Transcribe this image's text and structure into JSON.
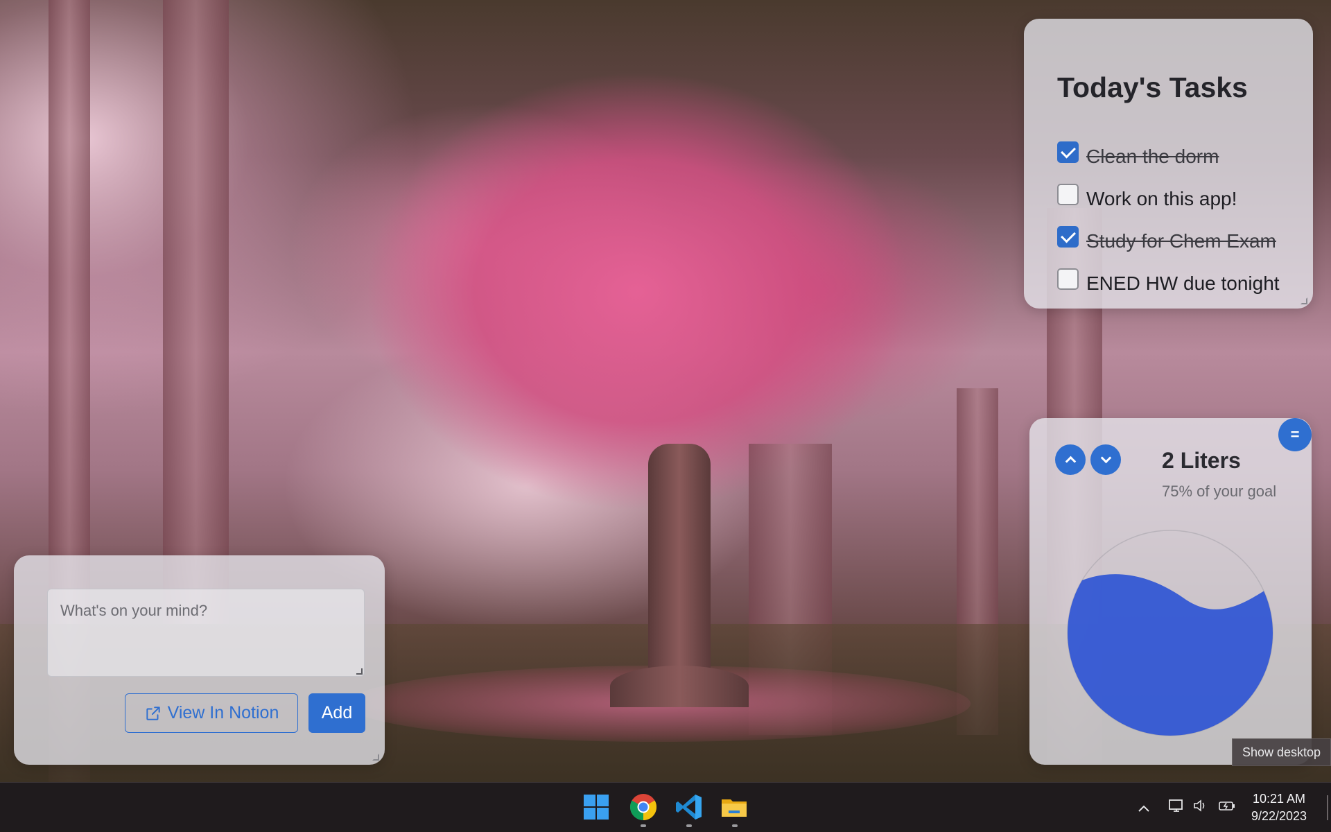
{
  "tasks_widget": {
    "title": "Today's Tasks",
    "items": [
      {
        "label": "Clean the dorm",
        "checked": true
      },
      {
        "label": "Work on this app!",
        "checked": false
      },
      {
        "label": "Study for Chem Exam",
        "checked": true
      },
      {
        "label": "ENED HW due tonight",
        "checked": false
      }
    ]
  },
  "water_widget": {
    "amount": "2 Liters",
    "goal_text": "75% of your goal",
    "progress_fraction": 0.75,
    "fill_color": "#2f55d4",
    "menu_label": "="
  },
  "notes_widget": {
    "placeholder": "What's on your mind?",
    "view_button": "View In Notion",
    "add_button": "Add"
  },
  "tooltip": "Show desktop",
  "taskbar": {
    "apps": [
      "windows-start-icon",
      "chrome-icon",
      "vscode-icon",
      "file-explorer-icon"
    ],
    "time": "10:21 AM",
    "date": "9/22/2023"
  },
  "colors": {
    "accent": "#2f6fd0",
    "widget_bg": "rgba(230,230,236,0.78)"
  }
}
